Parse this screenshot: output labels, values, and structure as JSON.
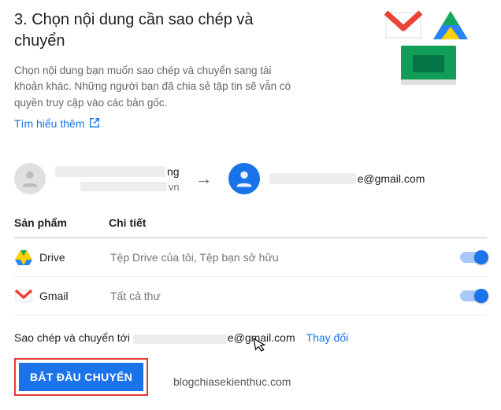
{
  "header": {
    "title": "3. Chọn nội dung cần sao chép và chuyển",
    "description": "Chọn nội dung bạn muốn sao chép và chuyển sang tài khoản khác. Những người bạn đã chia sẻ tập tin sẽ vẫn có quyền truy cập vào các bản gốc.",
    "learn_more": "Tìm hiểu thêm"
  },
  "accounts": {
    "source_name_suffix": "ng",
    "source_domain_suffix": "vn",
    "dest_email_suffix": "e@gmail.com"
  },
  "table": {
    "col_product": "Sản phẩm",
    "col_detail": "Chi tiết",
    "rows": [
      {
        "icon": "drive",
        "product": "Drive",
        "detail": "Tệp Drive của tôi, Tệp bạn sở hữu",
        "enabled": true
      },
      {
        "icon": "gmail",
        "product": "Gmail",
        "detail": "Tất cả thư",
        "enabled": true
      }
    ]
  },
  "footer": {
    "copy_prefix": "Sao chép và chuyển tới ",
    "dest_visible": "e@gmail.com",
    "change": "Thay đổi",
    "cta": "BẮT ĐẦU CHUYỂN"
  },
  "watermark": "blogchiasekienthuc.com"
}
